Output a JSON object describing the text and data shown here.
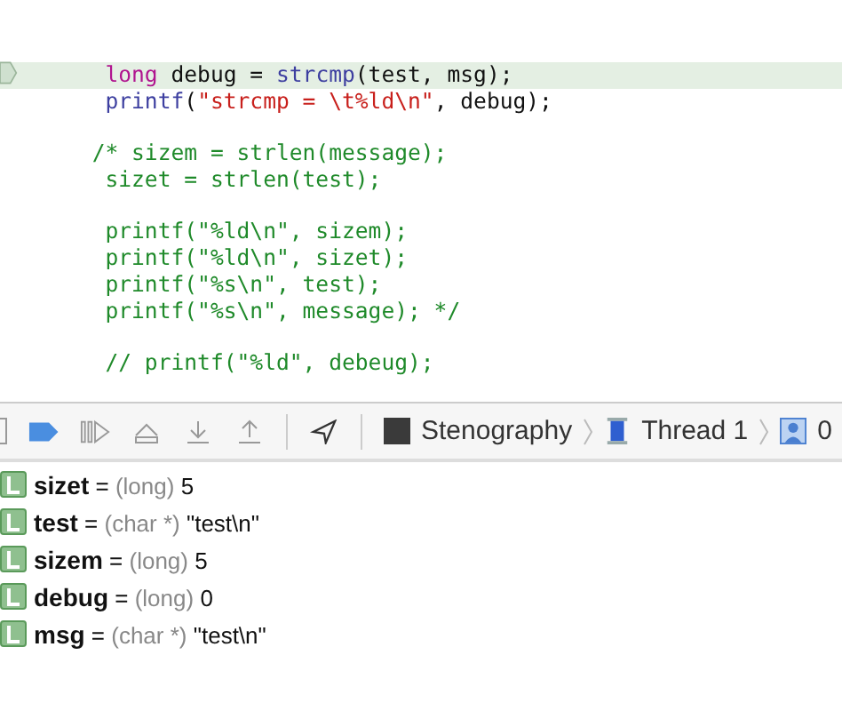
{
  "editor": {
    "blocks": [
      {
        "lines": [
          {
            "current": true,
            "segments": [
              {
                "kind": "keyword",
                "text": "        long"
              },
              {
                "kind": "plain",
                "text": " debug = "
              },
              {
                "kind": "func",
                "text": "strcmp"
              },
              {
                "kind": "plain",
                "text": "(test, msg);"
              }
            ]
          },
          {
            "current": false,
            "segments": [
              {
                "kind": "func",
                "text": "        printf"
              },
              {
                "kind": "plain",
                "text": "("
              },
              {
                "kind": "string",
                "text": "\"strcmp = \\t%ld\\n\""
              },
              {
                "kind": "plain",
                "text": ", debug);"
              }
            ]
          }
        ]
      },
      {
        "lines": [
          {
            "current": false,
            "segments": [
              {
                "kind": "comment",
                "text": "       /* sizem = strlen(message);"
              }
            ]
          },
          {
            "current": false,
            "segments": [
              {
                "kind": "comment",
                "text": "        sizet = strlen(test);"
              }
            ]
          }
        ]
      },
      {
        "lines": [
          {
            "current": false,
            "segments": [
              {
                "kind": "comment",
                "text": "        printf(\"%ld\\n\", sizem);"
              }
            ]
          },
          {
            "current": false,
            "segments": [
              {
                "kind": "comment",
                "text": "        printf(\"%ld\\n\", sizet);"
              }
            ]
          },
          {
            "current": false,
            "segments": [
              {
                "kind": "comment",
                "text": "        printf(\"%s\\n\", test);"
              }
            ]
          },
          {
            "current": false,
            "segments": [
              {
                "kind": "comment",
                "text": "        printf(\"%s\\n\", message); */"
              }
            ]
          }
        ]
      },
      {
        "lines": [
          {
            "current": false,
            "segments": [
              {
                "kind": "comment",
                "text": "        // printf(\"%ld\", debeug);"
              }
            ]
          }
        ]
      }
    ]
  },
  "debug_bar": {
    "breakpoints_active": true,
    "breadcrumbs": [
      {
        "kind": "app",
        "label": "Stenography"
      },
      {
        "kind": "thread",
        "label": "Thread 1"
      },
      {
        "kind": "frame",
        "label": "0"
      }
    ]
  },
  "variables": [
    {
      "name": "sizet",
      "operator": "=",
      "type": "(long)",
      "value": "5"
    },
    {
      "name": "test",
      "operator": "=",
      "type": "(char *)",
      "value": "\"test\\n\""
    },
    {
      "name": "sizem",
      "operator": "=",
      "type": "(long)",
      "value": "5"
    },
    {
      "name": "debug",
      "operator": "=",
      "type": "(long)",
      "value": "0"
    },
    {
      "name": "msg",
      "operator": "=",
      "type": "(char *)",
      "value": "\"test\\n\""
    }
  ]
}
